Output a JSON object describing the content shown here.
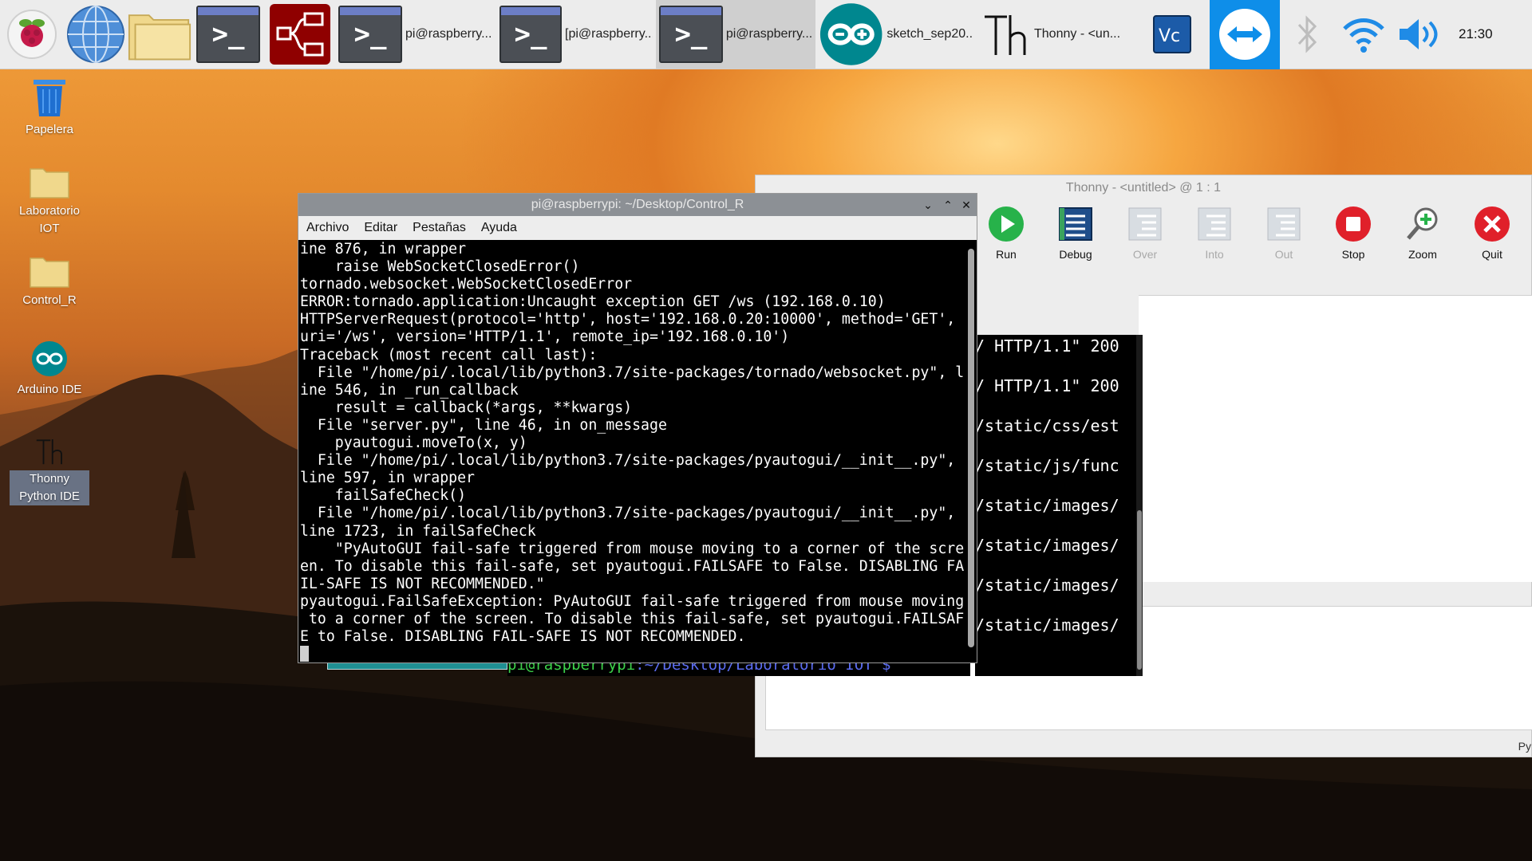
{
  "taskbar": {
    "tasks": [
      {
        "label": "pi@raspberry..."
      },
      {
        "label": "[pi@raspberry..."
      },
      {
        "label": "pi@raspberry..."
      },
      {
        "label": "sketch_sep20..."
      },
      {
        "label": "Thonny  -  <un..."
      }
    ],
    "clock": "21:30"
  },
  "desktop": {
    "icons": [
      {
        "label": "Papelera"
      },
      {
        "label": "Laboratorio IOT"
      },
      {
        "label": "Control_R"
      },
      {
        "label": "Arduino IDE"
      },
      {
        "label": "Thonny Python IDE"
      }
    ]
  },
  "thonny": {
    "title": "Thonny  -  <untitled>  @  1 : 1",
    "tools": [
      "Run",
      "Debug",
      "Over",
      "Into",
      "Out",
      "Stop",
      "Zoom",
      "Quit"
    ],
    "status": "Py"
  },
  "term2": {
    "lines": [
      "/ HTTP/1.1\" 200",
      "/ HTTP/1.1\" 200",
      "/static/css/est",
      "/static/js/func",
      "/static/images/",
      "/static/images/",
      "/static/images/",
      "/static/images/"
    ]
  },
  "term3": {
    "prompt_user": "pi@raspberrypi",
    "prompt_path": ":~/Desktop/Laboratorio IOT $"
  },
  "term1": {
    "title": "pi@raspberrypi: ~/Desktop/Control_R",
    "menu": [
      "Archivo",
      "Editar",
      "Pestañas",
      "Ayuda"
    ],
    "output": "ine 876, in wrapper\n    raise WebSocketClosedError()\ntornado.websocket.WebSocketClosedError\nERROR:tornado.application:Uncaught exception GET /ws (192.168.0.10)\nHTTPServerRequest(protocol='http', host='192.168.0.20:10000', method='GET',\nuri='/ws', version='HTTP/1.1', remote_ip='192.168.0.10')\nTraceback (most recent call last):\n  File \"/home/pi/.local/lib/python3.7/site-packages/tornado/websocket.py\", l\nine 546, in _run_callback\n    result = callback(*args, **kwargs)\n  File \"server.py\", line 46, in on_message\n    pyautogui.moveTo(x, y)\n  File \"/home/pi/.local/lib/python3.7/site-packages/pyautogui/__init__.py\",\nline 597, in wrapper\n    failSafeCheck()\n  File \"/home/pi/.local/lib/python3.7/site-packages/pyautogui/__init__.py\",\nline 1723, in failSafeCheck\n    \"PyAutoGUI fail-safe triggered from mouse moving to a corner of the scre\nen. To disable this fail-safe, set pyautogui.FAILSAFE to False. DISABLING FA\nIL-SAFE IS NOT RECOMMENDED.\"\npyautogui.FailSafeException: PyAutoGUI fail-safe triggered from mouse moving\n to a corner of the screen. To disable this fail-safe, set pyautogui.FAILSAF\nE to False. DISABLING FAIL-SAFE IS NOT RECOMMENDED."
  }
}
